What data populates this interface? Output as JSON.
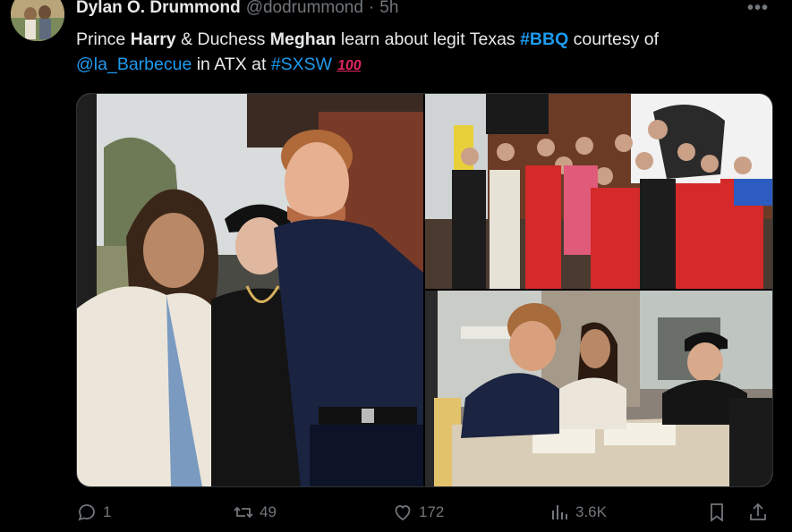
{
  "tweet": {
    "author_name": "Dylan O. Drummond",
    "handle": "@dodrummond",
    "separator": "·",
    "time": "5h",
    "text": {
      "p1": "Prince ",
      "harry": "Harry",
      "p2": " & Duchess ",
      "meghan": "Meghan",
      "p3": " learn about legit Texas ",
      "hashtag_bbq": "#BBQ",
      "p4": " courtesy of",
      "mention": "@la_Barbecue",
      "p5": " in ATX at ",
      "hashtag_sxsw": "#SXSW",
      "emoji": "100"
    }
  },
  "actions": {
    "replies": "1",
    "reposts": "49",
    "likes": "172",
    "views": "3.6K"
  },
  "icons": {
    "avatar": "avatar-photo",
    "more": "more-icon",
    "reply": "reply-icon",
    "repost": "repost-icon",
    "like": "heart-icon",
    "views": "views-icon",
    "bookmark": "bookmark-icon",
    "share": "share-icon"
  },
  "colors": {
    "background": "#000000",
    "text": "#e7e9ea",
    "muted": "#71767b",
    "link": "#1d9bf0",
    "apron_red": "#d42a2a"
  }
}
